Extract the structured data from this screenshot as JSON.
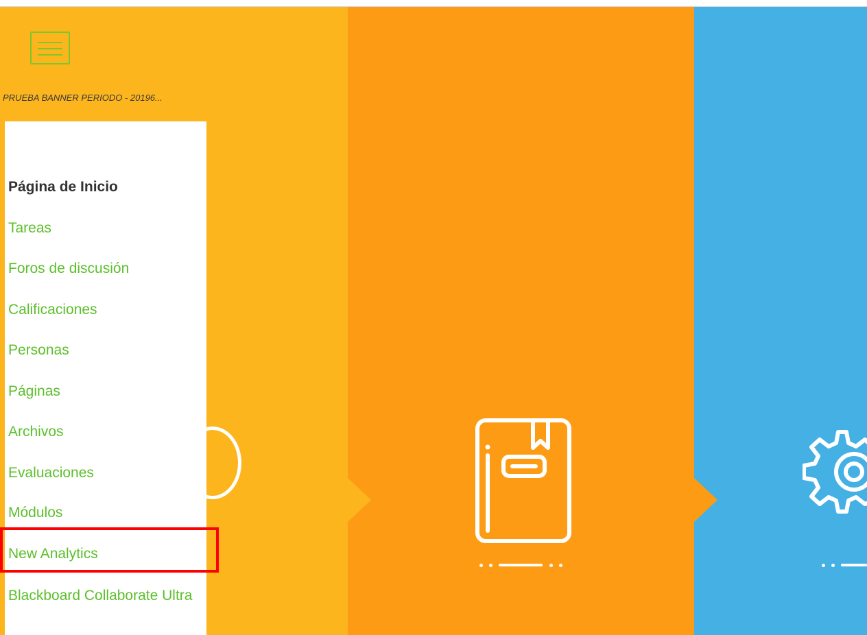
{
  "course": {
    "title": "PRUEBA BANNER PERIODO - 20196..."
  },
  "menu_icon": "hamburger-menu-icon",
  "nav": {
    "items": [
      {
        "label": "Página de Inicio",
        "active": true
      },
      {
        "label": "Tareas",
        "active": false
      },
      {
        "label": "Foros de discusión",
        "active": false
      },
      {
        "label": "Calificaciones",
        "active": false
      },
      {
        "label": "Personas",
        "active": false
      },
      {
        "label": "Páginas",
        "active": false
      },
      {
        "label": "Archivos",
        "active": false
      },
      {
        "label": "Evaluaciones",
        "active": false
      },
      {
        "label": "Módulos",
        "active": false
      },
      {
        "label": "New Analytics",
        "active": false,
        "highlighted": true
      },
      {
        "label": "Blackboard Collaborate Ultra",
        "active": false
      }
    ]
  },
  "banner": {
    "panels": [
      {
        "color": "#fdb51e",
        "icon": "circle-icon"
      },
      {
        "color": "#fd9c14",
        "icon": "notebook-icon"
      },
      {
        "color": "#45b0e4",
        "icon": "gear-icon"
      }
    ]
  },
  "colors": {
    "accent": "#5cbf2a",
    "highlight_border": "#ff0000",
    "active_text": "#333333"
  }
}
